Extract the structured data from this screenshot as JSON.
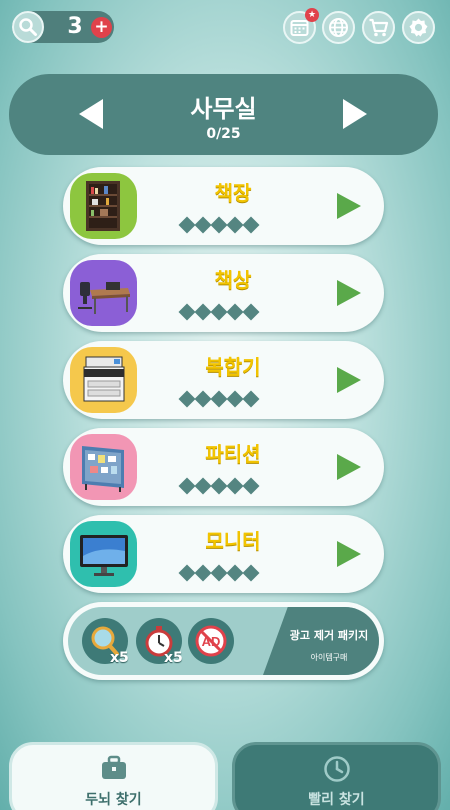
{
  "topbar": {
    "hint_count": "3",
    "plus_label": "+",
    "badge_star": "★"
  },
  "category": {
    "title": "사무실",
    "progress": "0/25"
  },
  "items": [
    {
      "name": "책장",
      "thumb_color": "#8dc63f"
    },
    {
      "name": "책상",
      "thumb_color": "#8b5fd6"
    },
    {
      "name": "복합기",
      "thumb_color": "#f5c84c"
    },
    {
      "name": "파티션",
      "thumb_color": "#f296b4"
    },
    {
      "name": "모니터",
      "thumb_color": "#2fbfae"
    }
  ],
  "ad_package": {
    "hint_x5": "x5",
    "timer_x5": "x5",
    "ad_label": "AD",
    "title": "광고 제거 패키지",
    "subtitle": "아이템구매"
  },
  "tabs": {
    "find_brain": "두뇌 찾기",
    "find_fast": "빨리 찾기"
  },
  "colors": {
    "accent_yellow": "#f2c400",
    "play_green": "#5aa94a",
    "badge_red": "#e0424b",
    "header_teal": "#4f8480"
  }
}
